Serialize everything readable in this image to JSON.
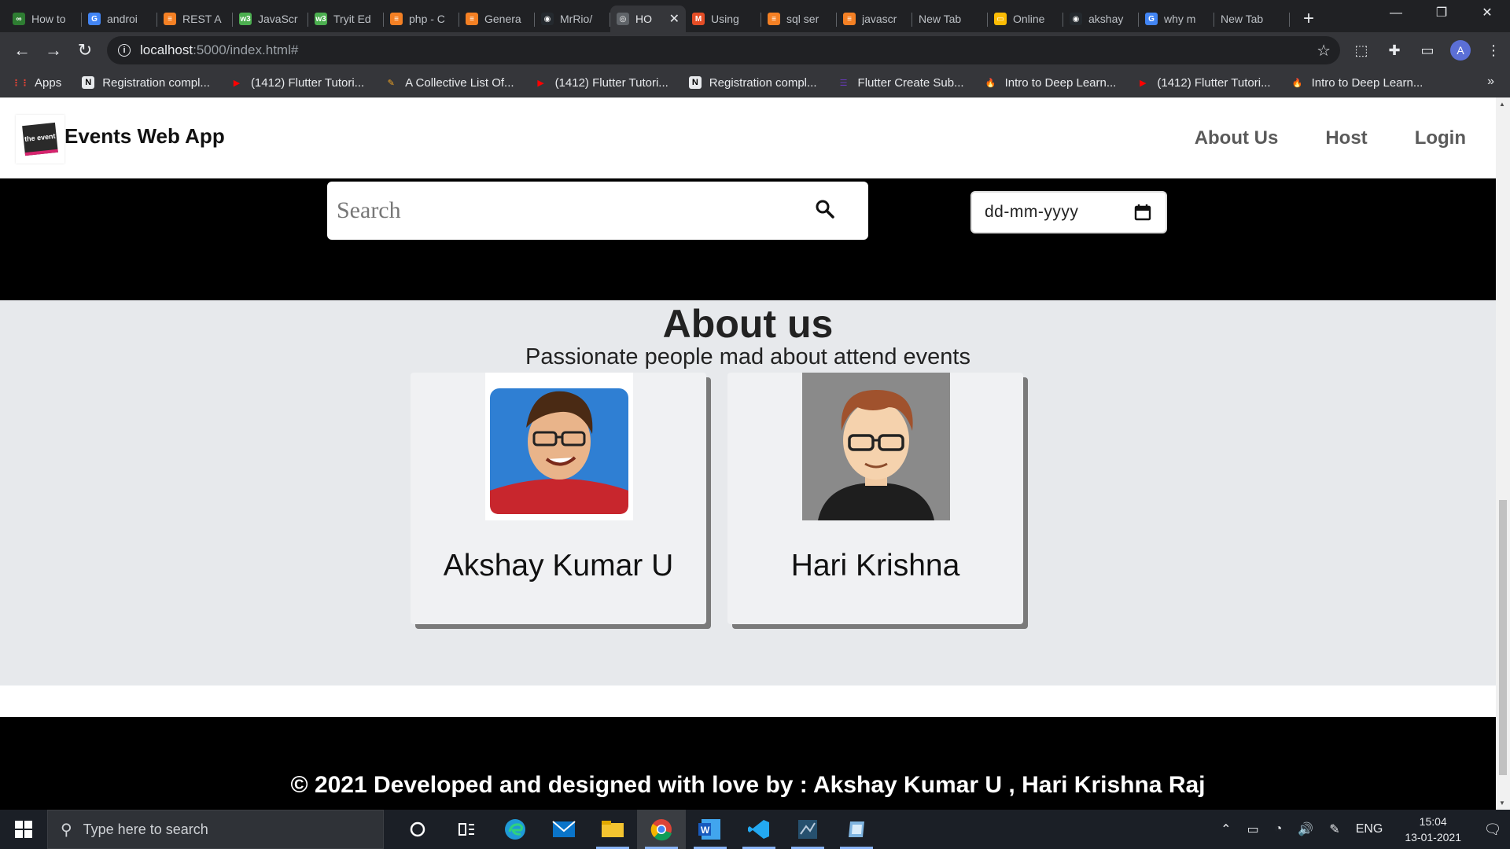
{
  "browser": {
    "tabs": [
      {
        "title": "How to",
        "fav_color": "#2e7d32",
        "fav_glyph": "∞"
      },
      {
        "title": "androi",
        "fav_color": "#4285f4",
        "fav_glyph": "G"
      },
      {
        "title": "REST A",
        "fav_color": "#f48024",
        "fav_glyph": "≡"
      },
      {
        "title": "JavaScr",
        "fav_color": "#4caf50",
        "fav_glyph": "w3"
      },
      {
        "title": "Tryit Ed",
        "fav_color": "#4caf50",
        "fav_glyph": "w3"
      },
      {
        "title": "php - C",
        "fav_color": "#f48024",
        "fav_glyph": "≡"
      },
      {
        "title": "Genera",
        "fav_color": "#f48024",
        "fav_glyph": "≡"
      },
      {
        "title": "MrRio/",
        "fav_color": "#24292e",
        "fav_glyph": "◉"
      },
      {
        "title": "HO",
        "fav_color": "#5f6368",
        "fav_glyph": "◎"
      },
      {
        "title": "Using",
        "fav_color": "#e44d26",
        "fav_glyph": "M"
      },
      {
        "title": "sql ser",
        "fav_color": "#f48024",
        "fav_glyph": "≡"
      },
      {
        "title": "javascr",
        "fav_color": "#f48024",
        "fav_glyph": "≡"
      },
      {
        "title": "New Tab",
        "fav_color": "",
        "fav_glyph": ""
      },
      {
        "title": "Online",
        "fav_color": "#fbbc04",
        "fav_glyph": "▭"
      },
      {
        "title": "akshay",
        "fav_color": "#24292e",
        "fav_glyph": "◉"
      },
      {
        "title": "why m",
        "fav_color": "#4285f4",
        "fav_glyph": "G"
      },
      {
        "title": "New Tab",
        "fav_color": "",
        "fav_glyph": ""
      }
    ],
    "active_tab_index": 8,
    "url_host": "localhost",
    "url_path": ":5000/index.html#",
    "profile_initial": "A",
    "bookmarks": [
      {
        "label": "Apps",
        "color": "#ea4335",
        "glyph": "⋮⋮"
      },
      {
        "label": "Registration compl...",
        "color": "#000000",
        "glyph": "N"
      },
      {
        "label": "(1412) Flutter Tutori...",
        "color": "#ff0000",
        "glyph": "▶"
      },
      {
        "label": "A Collective List Of...",
        "color": "#f4a623",
        "glyph": "✎"
      },
      {
        "label": "(1412) Flutter Tutori...",
        "color": "#ff0000",
        "glyph": "▶"
      },
      {
        "label": "Registration compl...",
        "color": "#000000",
        "glyph": "N"
      },
      {
        "label": "Flutter Create Sub...",
        "color": "#673ab7",
        "glyph": "☰"
      },
      {
        "label": "Intro to Deep Learn...",
        "color": "#ffa000",
        "glyph": "🔥"
      },
      {
        "label": "(1412) Flutter Tutori...",
        "color": "#ff0000",
        "glyph": "▶"
      },
      {
        "label": "Intro to Deep Learn...",
        "color": "#ffa000",
        "glyph": "🔥"
      }
    ]
  },
  "site": {
    "brand": "Events Web App",
    "logo_text": "the event",
    "nav": {
      "about": "About Us",
      "host": "Host",
      "login": "Login"
    },
    "search_placeholder": "Search",
    "date_placeholder": "dd-mm-yyyy",
    "about_title": "About us",
    "about_subtitle": "Passionate people mad about attend events",
    "team": [
      {
        "name": "Akshay Kumar U"
      },
      {
        "name": "Hari Krishna"
      }
    ],
    "footer": "© 2021 Developed and designed with love by : Akshay Kumar U , Hari Krishna Raj"
  },
  "taskbar": {
    "search_placeholder": "Type here to search",
    "language": "ENG",
    "time": "15:04",
    "date": "13-01-2021"
  }
}
